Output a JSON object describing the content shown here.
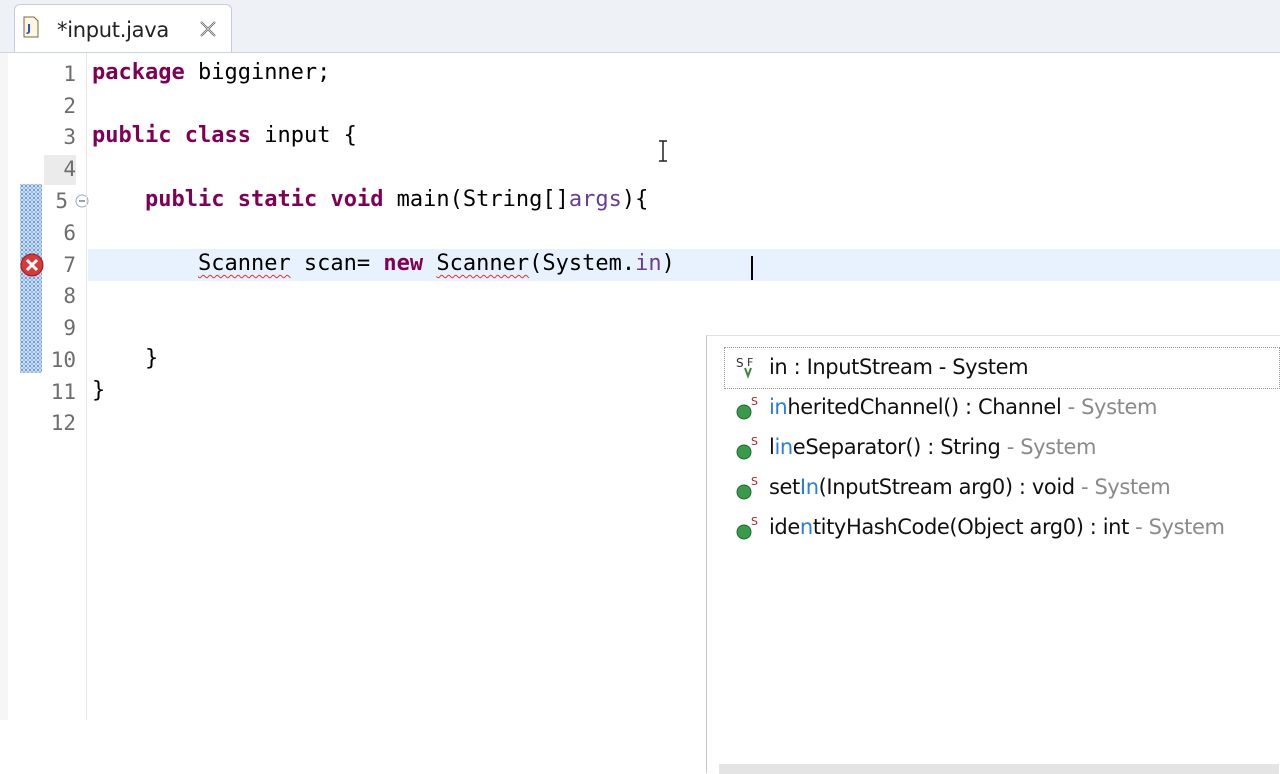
{
  "tab": {
    "title": "*input.java",
    "file_icon": "java-file-icon",
    "close_icon": "close-icon"
  },
  "editor": {
    "line_numbers": [
      "1",
      "2",
      "3",
      "4",
      "5",
      "6",
      "7",
      "8",
      "9",
      "10",
      "11",
      "12"
    ],
    "lines": {
      "l1_kw": "package",
      "l1_rest": " bigginner;",
      "l3_kw1": "public",
      "l3_kw2": "class",
      "l3_rest": " input {",
      "l5_kw1": "public",
      "l5_kw2": "static",
      "l5_kw3": "void",
      "l5_rest1": " main(String[]",
      "l5_param": "args",
      "l5_rest2": "){",
      "l7_type": "Scanner",
      "l7_rest1": " scan= ",
      "l7_kw": "new",
      "l7_ctor": "Scanner",
      "l7_rest2": "(System.",
      "l7_field": "in",
      "l7_rest3": ")",
      "l10": "}",
      "l11": "}"
    },
    "error_icon": "error-icon",
    "fold_icon": "fold-collapse-icon"
  },
  "content_assist": {
    "proposals": [
      {
        "icon": "static-field-icon",
        "match": "",
        "text": "in : InputStream - System",
        "qualifier": ""
      },
      {
        "icon": "static-method-icon",
        "match": "in",
        "text": "heritedChannel() : Channel ",
        "qualifier": "- System"
      },
      {
        "icon": "static-method-icon",
        "match": "",
        "text_a": "l",
        "match_b": "in",
        "text_b": "eSeparator() : String ",
        "qualifier": "- System"
      },
      {
        "icon": "static-method-icon",
        "text_a": "set",
        "match_b": "In",
        "text_b": "(InputStream arg0) : void ",
        "qualifier": "- System"
      },
      {
        "icon": "static-method-icon",
        "text_a": "ide",
        "match_b": "n",
        "text_b": "tityHashCode(Object arg0) : int ",
        "qualifier": "- System"
      }
    ]
  }
}
